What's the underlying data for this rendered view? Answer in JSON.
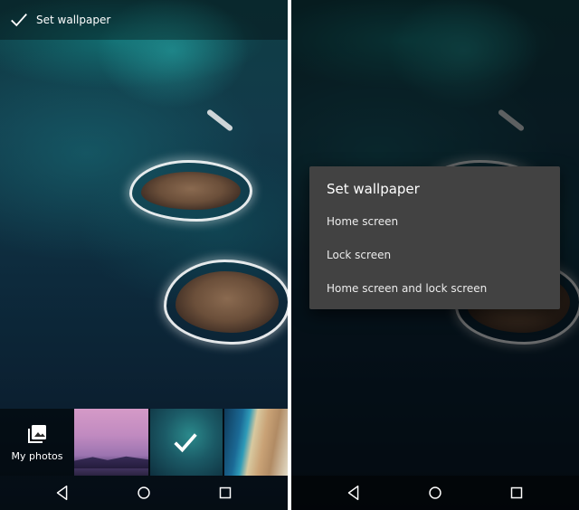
{
  "left_screen": {
    "topbar": {
      "check_icon": "check-icon",
      "title": "Set wallpaper"
    },
    "picker": {
      "my_photos_label": "My photos",
      "my_photos_icon": "photo-library-icon",
      "selected_thumbnail_index": 1
    },
    "navbar": {
      "icons": [
        "back-icon",
        "home-icon",
        "recents-icon"
      ]
    }
  },
  "right_screen": {
    "dialog": {
      "title": "Set wallpaper",
      "options": [
        "Home screen",
        "Lock screen",
        "Home screen and lock screen"
      ],
      "background": "#424242"
    },
    "navbar": {
      "icons": [
        "back-icon",
        "home-icon",
        "recents-icon"
      ]
    }
  }
}
